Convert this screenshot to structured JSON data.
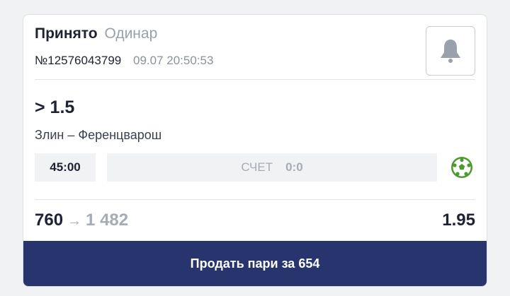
{
  "bet": {
    "status": "Принято",
    "type": "Одинар",
    "number": "№12576043799",
    "datetime": "09.07 20:50:53",
    "outcome": "> 1.5",
    "event": "Злин – Ференцварош",
    "timer": "45:00",
    "score_label": "СЧЕТ",
    "score_value": "0:0",
    "stake": "760",
    "arrow": "→",
    "payout": "1 482",
    "odds": "1.95"
  },
  "actions": {
    "sell_label": "Продать пари за 654"
  },
  "icons": {
    "bell": "bell-icon",
    "sport": "football-icon"
  },
  "colors": {
    "accent_button": "#27346e",
    "sport_icon": "#4e9a2e",
    "muted_text": "#9aa0ac"
  }
}
